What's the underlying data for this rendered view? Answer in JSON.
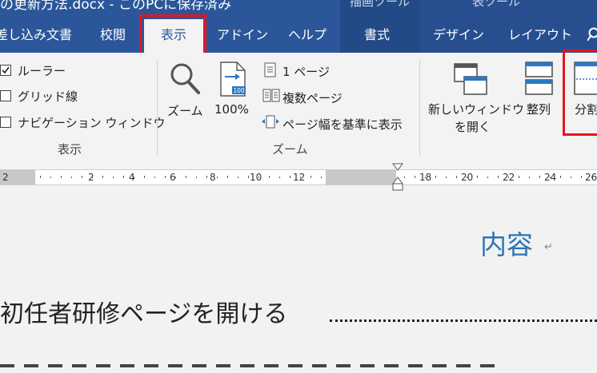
{
  "title_bar": {
    "doc_title_fragment": "の更新方法.docx - このPCに保存済み",
    "context_label_1": "描画ツール",
    "context_label_2": "表ツール"
  },
  "tabs": [
    {
      "label": "差し込み文書",
      "active": false
    },
    {
      "label": "校閲",
      "active": false
    },
    {
      "label": "表示",
      "active": true
    },
    {
      "label": "アドイン",
      "active": false
    },
    {
      "label": "ヘルプ",
      "active": false
    },
    {
      "label": "書式",
      "active": false
    },
    {
      "label": "デザイン",
      "active": false
    },
    {
      "label": "レイアウト",
      "active": false
    }
  ],
  "ribbon": {
    "show_group": {
      "items": [
        {
          "label": "ルーラー",
          "checked": true
        },
        {
          "label": "グリッド線",
          "checked": false
        },
        {
          "label": "ナビゲーション ウィンドウ",
          "checked": false
        }
      ],
      "label": "表示"
    },
    "zoom_group": {
      "zoom_label": "ズーム",
      "hundred_label": "100%",
      "hundred_icon_text": "100",
      "one_page": "1 ページ",
      "multi_page": "複数ページ",
      "page_width": "ページ幅を基準に表示",
      "label": "ズーム"
    },
    "window_group": {
      "new_window_line1": "新しいウィンドウ",
      "new_window_line2": "を開く",
      "arrange": "整列",
      "split": "分割"
    }
  },
  "ruler": {
    "labels": [
      "2",
      "2",
      "4",
      "6",
      "8",
      "10",
      "12",
      "18",
      "20",
      "22",
      "24",
      "26"
    ]
  },
  "document": {
    "heading": "内容",
    "toc_line": "初任者研修ページを開ける"
  },
  "colors": {
    "ribbon_blue": "#2b579a",
    "highlight_red": "#e8141c",
    "heading_blue": "#2e74b5"
  }
}
